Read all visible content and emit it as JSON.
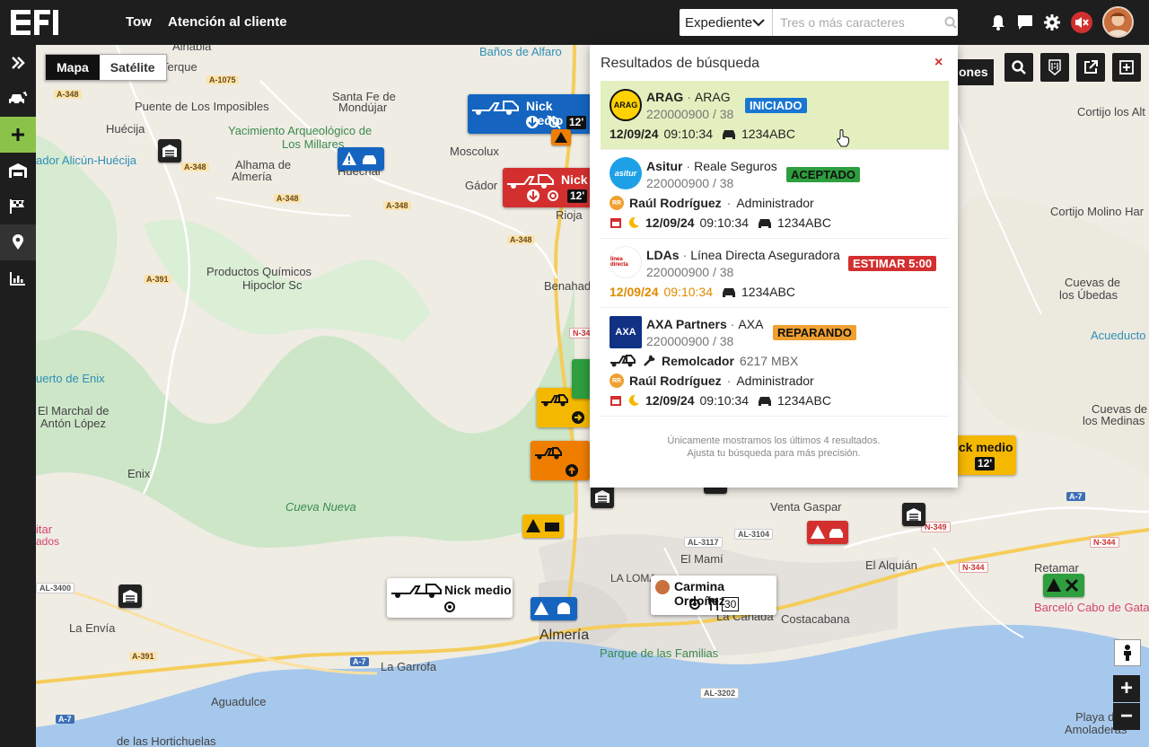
{
  "topbar": {
    "nav": [
      "Tow",
      "Atención al cliente"
    ],
    "search": {
      "field": "Expediente",
      "placeholder": "Tres o más caracteres"
    }
  },
  "maptype": {
    "map": "Mapa",
    "satellite": "Satélite"
  },
  "map_labels": {
    "alhabia": "Alhabia",
    "terque": "Terque",
    "santa_fe": "Santa Fe de",
    "mondujar": "Mondújar",
    "banos": "Baños de Alfaro",
    "puente": "Puente de Los Imposibles",
    "huecija": "Huécija",
    "yacimiento1": "Yacimiento Arqueológico de",
    "yacimiento2": "Los Millares",
    "alicun": "ador Alicún-Huécija",
    "alhama1": "Alhama de",
    "alhama2": "Almería",
    "huechar": "Huéchar",
    "moscolux": "Moscolux",
    "gador": "Gádor",
    "rioja": "Rioja",
    "productos1": "Productos Químicos",
    "productos2": "Hipoclor Sc",
    "benahad": "Benahad",
    "cortijo1": "Cortijo los Alt",
    "cortijo2": "Cortijo Molino Har",
    "cuevas_ubedas1": "Cuevas de",
    "cuevas_ubedas2": "los Úbedas",
    "acueducto": "Acueducto",
    "puerto_enix": "uerto de Enix",
    "marchal1": "El Marchal de",
    "marchal2": "Antón López",
    "enix": "Enix",
    "cuevas_medinas1": "Cuevas de",
    "cuevas_medinas2": "los Medinas",
    "cueva_nueva": "Cueva Nueva",
    "itar": "itar",
    "ados": "ados",
    "la_envia": "La Envía",
    "almeria": "Almería",
    "la_garrofa": "La Garrofa",
    "aguadulce": "Aguadulce",
    "hortichuelas": "de las Hortichuelas",
    "parque": "Parque de las Familias",
    "la_loma": "LA LOMA",
    "el_mami": "El Mamí",
    "venta_gaspar": "Venta Gaspar",
    "alquian": "El Alquián",
    "retamar": "Retamar",
    "costacabana": "Costacabana",
    "la_canada": "La Cañada",
    "barcelo": "Barceló Cabo de Gata",
    "playa1": "Playa de",
    "playa2": "Amoladeras",
    "ones": "ones"
  },
  "road_tags": [
    "A-348",
    "A-1075",
    "A-348",
    "A-348",
    "A-348",
    "A-348",
    "A-391",
    "N-340",
    "AL-3400",
    "A-391",
    "A-7",
    "A-7",
    "AL-3117",
    "AL-3104",
    "N-349",
    "A-7",
    "N-344",
    "N-344",
    "AL-3202"
  ],
  "markers": {
    "nick_blue": {
      "name": "Nick medio",
      "time": "12'"
    },
    "nick_red": {
      "name": "Nick",
      "time": "12'"
    },
    "nick_yellow": {
      "name": "ick medio",
      "time": "12'"
    },
    "nick_white": {
      "name": "Nick medio"
    },
    "carmina": {
      "name": "Carmina Ordoñez",
      "time": "30"
    }
  },
  "panel": {
    "title": "Resultados de búsqueda",
    "close": "×",
    "results": [
      {
        "company": "ARAG",
        "insurer": "ARAG",
        "ref": "220000900 / 38",
        "status": "INICIADO",
        "status_color": "#1976d2",
        "date": "12/09/24",
        "time": "09:10:34",
        "plate": "1234ABC"
      },
      {
        "company": "Asitur",
        "insurer": "Reale Seguros",
        "ref": "220000900 / 38",
        "status": "ACEPTADO",
        "status_color": "#2e9e3f",
        "person": "Raúl Rodríguez",
        "role": "Administrador",
        "date": "12/09/24",
        "time": "09:10:34",
        "plate": "1234ABC"
      },
      {
        "company": "LDAs",
        "insurer": "Línea Directa Aseguradora",
        "ref": "220000900 / 38",
        "status": "ESTIMAR 5:00",
        "status_color": "#d32f2f",
        "date": "12/09/24",
        "time": "09:10:34",
        "plate": "1234ABC"
      },
      {
        "company": "AXA Partners",
        "insurer": "AXA",
        "ref": "220000900 / 38",
        "status": "REPARANDO",
        "status_color": "#f0a030",
        "vehicle": "Remolcador",
        "vehicle_plate": "6217 MBX",
        "person": "Raúl Rodríguez",
        "role": "Administrador",
        "date": "12/09/24",
        "time": "09:10:34",
        "plate": "1234ABC"
      }
    ],
    "footer1": "Únicamente mostramos los últimos 4 resultados.",
    "footer2": "Ajusta tu búsqueda para más precisión."
  },
  "logos": {
    "arag": "ARAG",
    "asitur": "asitur",
    "ldas": "línea directa",
    "axa": "AXA",
    "rr": "RR"
  },
  "zoom": {
    "in": "+",
    "out": "−"
  },
  "colors": {
    "green": "#8bc34a",
    "blue": "#1565c0",
    "red": "#d32f2f",
    "yellow": "#f5b800",
    "orange": "#ef7d00"
  }
}
